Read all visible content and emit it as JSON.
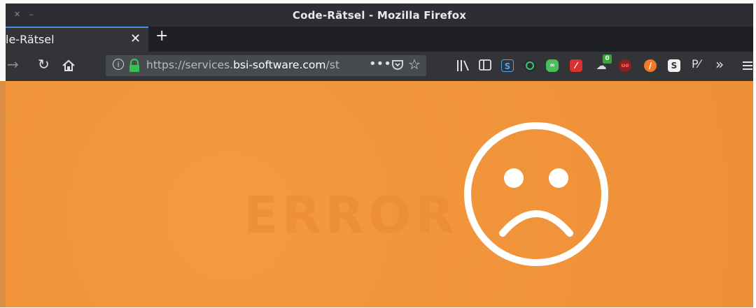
{
  "window": {
    "title": "Code-Rätsel - Mozilla Firefox"
  },
  "tabs": [
    {
      "label": "le-Rätsel",
      "active": true
    }
  ],
  "new_tab_label": "+",
  "navbar": {
    "url_prefix": "https://services.",
    "url_domain": "bsi-software.com",
    "url_path": "/st",
    "toolbar_icons": [
      "library-icon",
      "sidebar-icon",
      "s-extension-icon",
      "circle-extension-icon",
      "green-extension-icon",
      "red-extension-icon",
      "badge-extension-icon",
      "ublock-icon",
      "orange-circle-icon",
      "s-badge-icon",
      "py-icon",
      "overflow-chevron-icon",
      "menu-icon"
    ],
    "badge_count": "0"
  },
  "content": {
    "background_color": "#f2963a",
    "ghost_text": "ERROR"
  }
}
